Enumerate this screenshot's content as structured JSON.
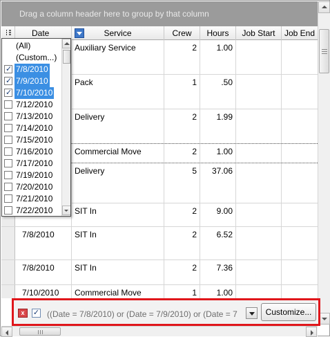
{
  "group_panel": {
    "text": "Drag a column header here to group by that column"
  },
  "columns": [
    "Date",
    "Service",
    "Crew",
    "Hours",
    "Job Start",
    "Job End"
  ],
  "rows": [
    {
      "date": "",
      "service": "Auxiliary Service",
      "crew": "2",
      "hours": "1.00"
    },
    {
      "date": "",
      "service": "Pack",
      "crew": "1",
      "hours": ".50"
    },
    {
      "date": "",
      "service": "Delivery",
      "crew": "2",
      "hours": "1.99"
    },
    {
      "date": "",
      "service": "Commercial Move",
      "crew": "2",
      "hours": "1.00"
    },
    {
      "date": "",
      "service": "Delivery",
      "crew": "5",
      "hours": "37.06"
    },
    {
      "date": "",
      "service": "SIT In",
      "crew": "2",
      "hours": "9.00"
    },
    {
      "date": "7/8/2010",
      "service": "SIT In",
      "crew": "2",
      "hours": "6.52"
    },
    {
      "date": "7/8/2010",
      "service": "SIT In",
      "crew": "2",
      "hours": "7.36"
    },
    {
      "date": "7/10/2010",
      "service": "Commercial Move",
      "crew": "1",
      "hours": "1.00"
    }
  ],
  "filter_popup": {
    "items": [
      {
        "label": "(All)",
        "checkbox": false,
        "checked": false,
        "selected": false
      },
      {
        "label": "(Custom...)",
        "checkbox": false,
        "checked": false,
        "selected": false
      },
      {
        "label": "7/8/2010",
        "checkbox": true,
        "checked": true,
        "selected": true
      },
      {
        "label": "7/9/2010",
        "checkbox": true,
        "checked": true,
        "selected": true
      },
      {
        "label": "7/10/2010",
        "checkbox": true,
        "checked": true,
        "selected": true
      },
      {
        "label": "7/12/2010",
        "checkbox": true,
        "checked": false,
        "selected": false
      },
      {
        "label": "7/13/2010",
        "checkbox": true,
        "checked": false,
        "selected": false
      },
      {
        "label": "7/14/2010",
        "checkbox": true,
        "checked": false,
        "selected": false
      },
      {
        "label": "7/15/2010",
        "checkbox": true,
        "checked": false,
        "selected": false
      },
      {
        "label": "7/16/2010",
        "checkbox": true,
        "checked": false,
        "selected": false
      },
      {
        "label": "7/17/2010",
        "checkbox": true,
        "checked": false,
        "selected": false
      },
      {
        "label": "7/19/2010",
        "checkbox": true,
        "checked": false,
        "selected": false
      },
      {
        "label": "7/20/2010",
        "checkbox": true,
        "checked": false,
        "selected": false
      },
      {
        "label": "7/21/2010",
        "checkbox": true,
        "checked": false,
        "selected": false
      },
      {
        "label": "7/22/2010",
        "checkbox": true,
        "checked": false,
        "selected": false
      }
    ]
  },
  "filter_bar": {
    "enabled": true,
    "clear_icon": "x",
    "expression": "((Date = 7/8/2010) or (Date = 7/9/2010) or (Date = 7",
    "customize_label": "Customize..."
  },
  "colors": {
    "accent": "#e0161b",
    "selection": "#3b8fe3",
    "group_panel_bg": "#9b9b9b"
  }
}
